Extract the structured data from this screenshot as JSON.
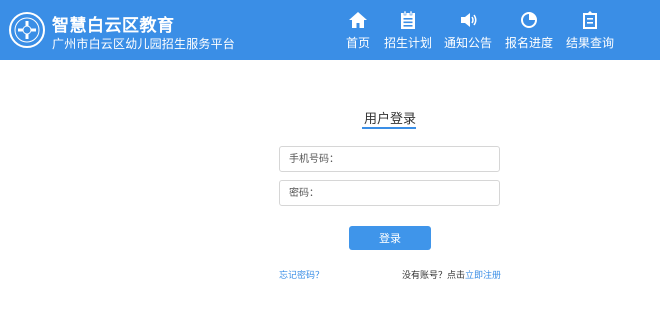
{
  "header": {
    "title": "智慧白云区教育",
    "subtitle": "广州市白云区幼儿园招生服务平台",
    "background_color": "#3a8ee6",
    "logo_icon": "emblem-logo",
    "nav": [
      {
        "label": "首页",
        "icon": "home-icon"
      },
      {
        "label": "招生计划",
        "icon": "clipboard-icon"
      },
      {
        "label": "通知公告",
        "icon": "speaker-icon"
      },
      {
        "label": "报名进度",
        "icon": "pie-chart-icon"
      },
      {
        "label": "结果查询",
        "icon": "document-icon"
      }
    ]
  },
  "login": {
    "title": "用户登录",
    "phone_placeholder": "手机号码：",
    "phone_value": "",
    "password_placeholder": "密码：",
    "password_value": "",
    "submit_label": "登录",
    "forgot_label": "忘记密码？",
    "no_account_text": "没有账号？点击",
    "register_label": "立即注册",
    "accent_color": "#3a8ee6"
  }
}
